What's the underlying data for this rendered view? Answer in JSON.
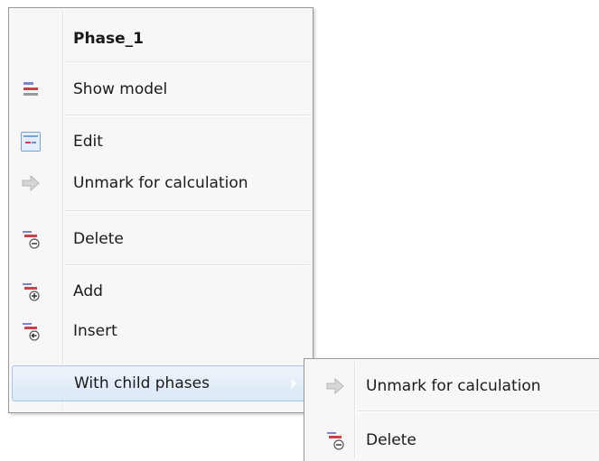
{
  "context_menu": {
    "title": "Phase_1",
    "items": {
      "show_model": "Show model",
      "edit": "Edit",
      "unmark": "Unmark for calculation",
      "delete": "Delete",
      "add": "Add",
      "insert": "Insert",
      "with_child_phases": "With child phases"
    },
    "icons": {
      "show_model": "model-lines-icon",
      "edit": "edit-phase-icon",
      "unmark": "arrow-right-icon",
      "delete": "phase-delete-icon",
      "add": "phase-add-icon",
      "insert": "phase-insert-icon",
      "submenu": "submenu-arrow-icon"
    }
  },
  "submenu": {
    "items": {
      "unmark": "Unmark for calculation",
      "delete": "Delete"
    }
  },
  "colors": {
    "menu_background": "#f7f7f7",
    "hover_border": "#adc7e6",
    "icon_blue": "#7a86c9",
    "icon_red": "#c8414b"
  }
}
